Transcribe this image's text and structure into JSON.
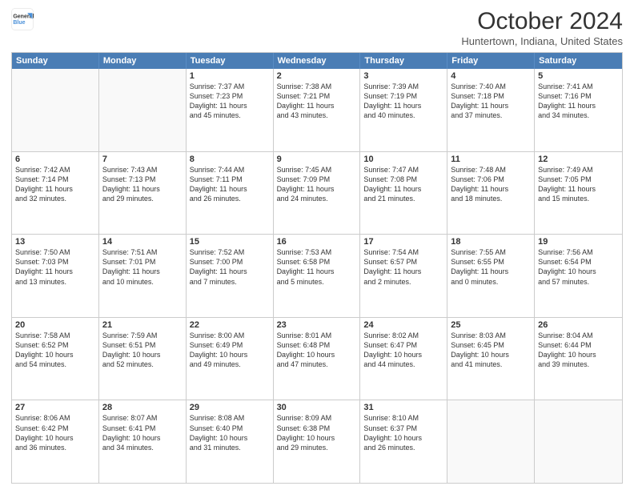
{
  "logo": {
    "line1": "General",
    "line2": "Blue"
  },
  "title": "October 2024",
  "location": "Huntertown, Indiana, United States",
  "weekdays": [
    "Sunday",
    "Monday",
    "Tuesday",
    "Wednesday",
    "Thursday",
    "Friday",
    "Saturday"
  ],
  "weeks": [
    [
      {
        "day": "",
        "text": ""
      },
      {
        "day": "",
        "text": ""
      },
      {
        "day": "1",
        "text": "Sunrise: 7:37 AM\nSunset: 7:23 PM\nDaylight: 11 hours\nand 45 minutes."
      },
      {
        "day": "2",
        "text": "Sunrise: 7:38 AM\nSunset: 7:21 PM\nDaylight: 11 hours\nand 43 minutes."
      },
      {
        "day": "3",
        "text": "Sunrise: 7:39 AM\nSunset: 7:19 PM\nDaylight: 11 hours\nand 40 minutes."
      },
      {
        "day": "4",
        "text": "Sunrise: 7:40 AM\nSunset: 7:18 PM\nDaylight: 11 hours\nand 37 minutes."
      },
      {
        "day": "5",
        "text": "Sunrise: 7:41 AM\nSunset: 7:16 PM\nDaylight: 11 hours\nand 34 minutes."
      }
    ],
    [
      {
        "day": "6",
        "text": "Sunrise: 7:42 AM\nSunset: 7:14 PM\nDaylight: 11 hours\nand 32 minutes."
      },
      {
        "day": "7",
        "text": "Sunrise: 7:43 AM\nSunset: 7:13 PM\nDaylight: 11 hours\nand 29 minutes."
      },
      {
        "day": "8",
        "text": "Sunrise: 7:44 AM\nSunset: 7:11 PM\nDaylight: 11 hours\nand 26 minutes."
      },
      {
        "day": "9",
        "text": "Sunrise: 7:45 AM\nSunset: 7:09 PM\nDaylight: 11 hours\nand 24 minutes."
      },
      {
        "day": "10",
        "text": "Sunrise: 7:47 AM\nSunset: 7:08 PM\nDaylight: 11 hours\nand 21 minutes."
      },
      {
        "day": "11",
        "text": "Sunrise: 7:48 AM\nSunset: 7:06 PM\nDaylight: 11 hours\nand 18 minutes."
      },
      {
        "day": "12",
        "text": "Sunrise: 7:49 AM\nSunset: 7:05 PM\nDaylight: 11 hours\nand 15 minutes."
      }
    ],
    [
      {
        "day": "13",
        "text": "Sunrise: 7:50 AM\nSunset: 7:03 PM\nDaylight: 11 hours\nand 13 minutes."
      },
      {
        "day": "14",
        "text": "Sunrise: 7:51 AM\nSunset: 7:01 PM\nDaylight: 11 hours\nand 10 minutes."
      },
      {
        "day": "15",
        "text": "Sunrise: 7:52 AM\nSunset: 7:00 PM\nDaylight: 11 hours\nand 7 minutes."
      },
      {
        "day": "16",
        "text": "Sunrise: 7:53 AM\nSunset: 6:58 PM\nDaylight: 11 hours\nand 5 minutes."
      },
      {
        "day": "17",
        "text": "Sunrise: 7:54 AM\nSunset: 6:57 PM\nDaylight: 11 hours\nand 2 minutes."
      },
      {
        "day": "18",
        "text": "Sunrise: 7:55 AM\nSunset: 6:55 PM\nDaylight: 11 hours\nand 0 minutes."
      },
      {
        "day": "19",
        "text": "Sunrise: 7:56 AM\nSunset: 6:54 PM\nDaylight: 10 hours\nand 57 minutes."
      }
    ],
    [
      {
        "day": "20",
        "text": "Sunrise: 7:58 AM\nSunset: 6:52 PM\nDaylight: 10 hours\nand 54 minutes."
      },
      {
        "day": "21",
        "text": "Sunrise: 7:59 AM\nSunset: 6:51 PM\nDaylight: 10 hours\nand 52 minutes."
      },
      {
        "day": "22",
        "text": "Sunrise: 8:00 AM\nSunset: 6:49 PM\nDaylight: 10 hours\nand 49 minutes."
      },
      {
        "day": "23",
        "text": "Sunrise: 8:01 AM\nSunset: 6:48 PM\nDaylight: 10 hours\nand 47 minutes."
      },
      {
        "day": "24",
        "text": "Sunrise: 8:02 AM\nSunset: 6:47 PM\nDaylight: 10 hours\nand 44 minutes."
      },
      {
        "day": "25",
        "text": "Sunrise: 8:03 AM\nSunset: 6:45 PM\nDaylight: 10 hours\nand 41 minutes."
      },
      {
        "day": "26",
        "text": "Sunrise: 8:04 AM\nSunset: 6:44 PM\nDaylight: 10 hours\nand 39 minutes."
      }
    ],
    [
      {
        "day": "27",
        "text": "Sunrise: 8:06 AM\nSunset: 6:42 PM\nDaylight: 10 hours\nand 36 minutes."
      },
      {
        "day": "28",
        "text": "Sunrise: 8:07 AM\nSunset: 6:41 PM\nDaylight: 10 hours\nand 34 minutes."
      },
      {
        "day": "29",
        "text": "Sunrise: 8:08 AM\nSunset: 6:40 PM\nDaylight: 10 hours\nand 31 minutes."
      },
      {
        "day": "30",
        "text": "Sunrise: 8:09 AM\nSunset: 6:38 PM\nDaylight: 10 hours\nand 29 minutes."
      },
      {
        "day": "31",
        "text": "Sunrise: 8:10 AM\nSunset: 6:37 PM\nDaylight: 10 hours\nand 26 minutes."
      },
      {
        "day": "",
        "text": ""
      },
      {
        "day": "",
        "text": ""
      }
    ]
  ]
}
